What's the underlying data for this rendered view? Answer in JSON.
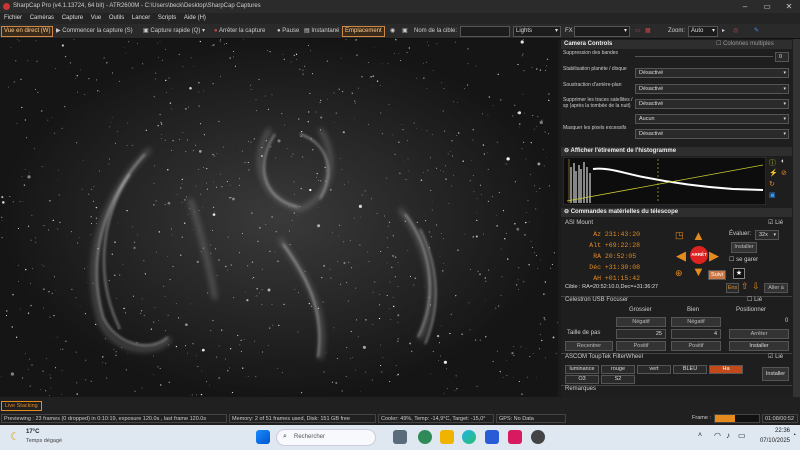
{
  "window": {
    "title": "SharpCap Pro (v4.1.13724, 64 bit) - ATR2600M - C:\\Users\\beck\\Desktop\\SharpCap Captures"
  },
  "menu": [
    "Fichier",
    "Caméras",
    "Capture",
    "Vue",
    "Outils",
    "Lancer",
    "Scripts",
    "Aide (H)"
  ],
  "toolbar": {
    "live_view": "Vue en direct (W)",
    "start_capture": "Commencer la capture (S)",
    "quick_capture": "Capture rapide (Q)",
    "stop_capture": "Arrêter la capture",
    "pause": "Pause",
    "snapshot": "Instantané",
    "location": "Emplacement",
    "target_label": "Nom de la cible:",
    "target_value": "",
    "frame_type": "Lights",
    "fx": "FX",
    "fx_value": "",
    "zoom_label": "Zoom:",
    "zoom_value": "Auto"
  },
  "camera_controls": {
    "title": "Camera Controls",
    "multi_columns": "Colonnes multiples",
    "rows": [
      {
        "label": "Suppression des bandes",
        "value": "0"
      },
      {
        "label": "Stabilisation planète / disque",
        "value": "Désactivé"
      },
      {
        "label": "Soustraction d'arrière-plan",
        "value": "Désactivé"
      },
      {
        "label": "Supprimer les traces satellites / sp (après la tombée de la nuit)",
        "value": "Désactivé"
      },
      {
        "label": "Masquer les pixels excessifs",
        "value": "Aucun"
      },
      {
        "label": "",
        "value": "Désactivé"
      }
    ]
  },
  "histogram": {
    "title": "Afficher l'étirement de l'histogramme"
  },
  "telescope": {
    "title": "Commandes matérielles du télescope",
    "mount_name": "ASI Mount",
    "connected_label": "Lié",
    "coords": [
      {
        "k": "Az",
        "v": "231:43:20"
      },
      {
        "k": "Alt",
        "v": "+69:22:28"
      },
      {
        "k": "RA",
        "v": "20:52:05"
      },
      {
        "k": "Déc",
        "v": "+31:30:08"
      },
      {
        "k": "AH",
        "v": "+01:15:42"
      }
    ],
    "rate_label": "Évaluer:",
    "rate_value": "32x",
    "install": "Installer",
    "park": "se garer",
    "stop": "ARRÊT",
    "follow": "Suivi",
    "goto": "Aller à",
    "target": "Cible : RA=20:52:10.0,Dec=+31:36:27",
    "ens": "Ens"
  },
  "focuser": {
    "title": "Celestron USB Focuser",
    "connected_label": "Lié",
    "col_coarse": "Grossier",
    "col_fine": "Bien",
    "col_position": "Positionner",
    "negative": "Négatif",
    "positive": "Positif",
    "step_label": "Taille de pas",
    "coarse_step": "25",
    "fine_step": "4",
    "position": "0",
    "stop": "Arrêter",
    "recenter": "Recentrer",
    "install": "Installer"
  },
  "filterwheel": {
    "title": "ASCOM ToupTek FilterWheel",
    "connected_label": "Lié",
    "filters": [
      "luminance",
      "rouge",
      "vert",
      "BLEU",
      "Ha",
      "O3",
      "S2"
    ],
    "active": "Ha",
    "install": "Installer",
    "notes": "Remarques"
  },
  "status": {
    "live_stacking": "Live Stacking",
    "previewing": "Previewing : 23 frames (0 dropped) in 0:10:19, exposure 120.0s , last frame 120.0s",
    "memory": "Memory: 2 of 51 frames used, Disk: 151 GB free",
    "cooler": "Cooler: 49%, Temp: -14,9°C, Target: -15,0°",
    "gps": "GPS: No Data",
    "frame_label": "Frame :",
    "frame_progress": 0.45,
    "elapsed": "01:08/00:52"
  },
  "taskbar": {
    "weather_temp": "17°C",
    "weather_text": "Temps dégagé",
    "search_placeholder": "Rechercher",
    "time": "22:36",
    "date": "07/10/2025"
  },
  "colors": {
    "accent": "#e58a1f",
    "dark_bg": "#1b1b1b",
    "panel_header": "#2e2e2e"
  }
}
